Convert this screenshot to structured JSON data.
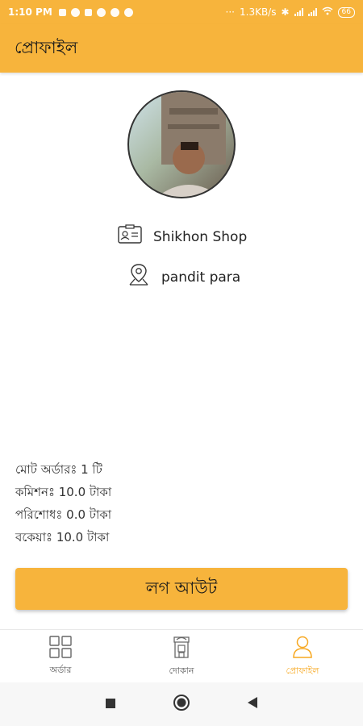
{
  "status_bar": {
    "time": "1:10 PM",
    "network_speed": "1.3KB/s",
    "battery": "66"
  },
  "app_bar": {
    "title": "প্রোফাইল"
  },
  "profile": {
    "shop_name": "Shikhon Shop",
    "address": "pandit para"
  },
  "stats": {
    "total_orders": "মোট অর্ডারঃ 1 টি",
    "commission": "কমিশনঃ 10.0 টাকা",
    "paid": "পরিশোধঃ 0.0 টাকা",
    "due": "বকেয়াঃ 10.0 টাকা"
  },
  "logout_label": "লগ আউট",
  "bottom_nav": {
    "orders": "অর্ডার",
    "shop": "দোকান",
    "profile": "প্রোফাইল"
  },
  "colors": {
    "accent": "#f7b43c",
    "active_tab": "#f7a821"
  },
  "icons": [
    "id-card-icon",
    "location-pin-icon",
    "grid-icon",
    "store-icon",
    "person-icon"
  ]
}
